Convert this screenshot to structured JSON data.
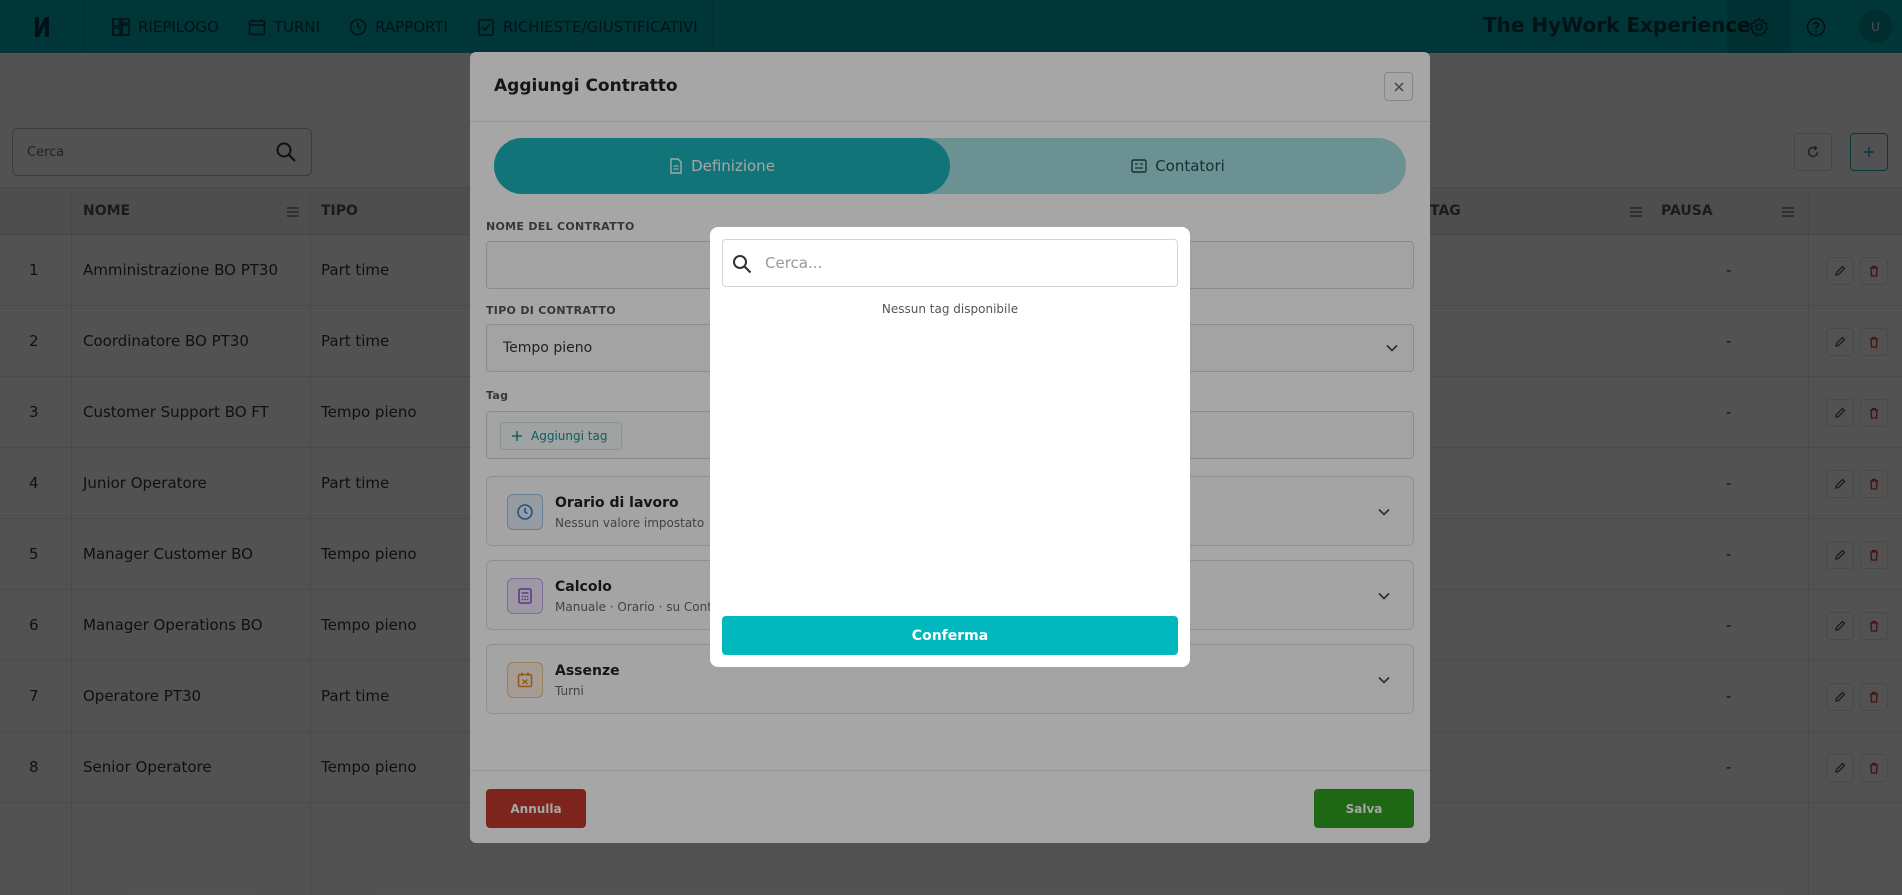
{
  "topbar": {
    "nav": [
      {
        "label": "RIEPILOGO",
        "icon": "dashboard-icon"
      },
      {
        "label": "TURNI",
        "icon": "calendar-icon"
      },
      {
        "label": "RAPPORTI",
        "icon": "clock-icon"
      },
      {
        "label": "RICHIESTE/GIUSTIFICATIVI",
        "icon": "checklist-icon"
      }
    ],
    "brand": "The HyWork Experience",
    "avatar": "U"
  },
  "background": {
    "search_placeholder": "Cerca",
    "columns": {
      "nome": "NOME",
      "tipo": "TIPO",
      "tag": "TAG",
      "pausa": "PAUSA"
    },
    "rows": [
      {
        "num": "1",
        "nome": "Amministrazione BO PT30",
        "tipo": "Part time",
        "pausa": "-"
      },
      {
        "num": "2",
        "nome": "Coordinatore BO PT30",
        "tipo": "Part time",
        "pausa": "-"
      },
      {
        "num": "3",
        "nome": "Customer Support BO FT",
        "tipo": "Tempo pieno",
        "pausa": "-"
      },
      {
        "num": "4",
        "nome": "Junior Operatore",
        "tipo": "Part time",
        "pausa": "-"
      },
      {
        "num": "5",
        "nome": "Manager Customer BO",
        "tipo": "Tempo pieno",
        "pausa": "-"
      },
      {
        "num": "6",
        "nome": "Manager Operations BO",
        "tipo": "Tempo pieno",
        "pausa": "-"
      },
      {
        "num": "7",
        "nome": "Operatore PT30",
        "tipo": "Part time",
        "pausa": "-"
      },
      {
        "num": "8",
        "nome": "Senior Operatore",
        "tipo": "Tempo pieno",
        "pausa": "-"
      }
    ]
  },
  "modal": {
    "title": "Aggiungi Contratto",
    "tabs": {
      "definizione": "Definizione",
      "contatori": "Contatori"
    },
    "nome_label": "NOME DEL CONTRATTO",
    "nome_value": "",
    "tipo_label": "TIPO DI CONTRATTO",
    "tipo_value": "Tempo pieno",
    "tag_label": "Tag",
    "add_tag": "Aggiungi tag",
    "sections": [
      {
        "title": "Orario di lavoro",
        "subtitle": "Nessun valore impostato",
        "icon": "clock-icon"
      },
      {
        "title": "Calcolo",
        "subtitle": "Manuale · Orario · su Contr",
        "icon": "calculator-icon"
      },
      {
        "title": "Assenze",
        "subtitle": "Turni",
        "icon": "calendar-x-icon"
      }
    ],
    "cancel": "Annulla",
    "save": "Salva"
  },
  "popup": {
    "search_placeholder": "Cerca...",
    "empty": "Nessun tag disponibile",
    "confirm": "Conferma"
  },
  "colors": {
    "topbar": "#00a9ad",
    "accent": "#00b8be",
    "danger": "#c0392b",
    "success": "#2e9e1f"
  }
}
